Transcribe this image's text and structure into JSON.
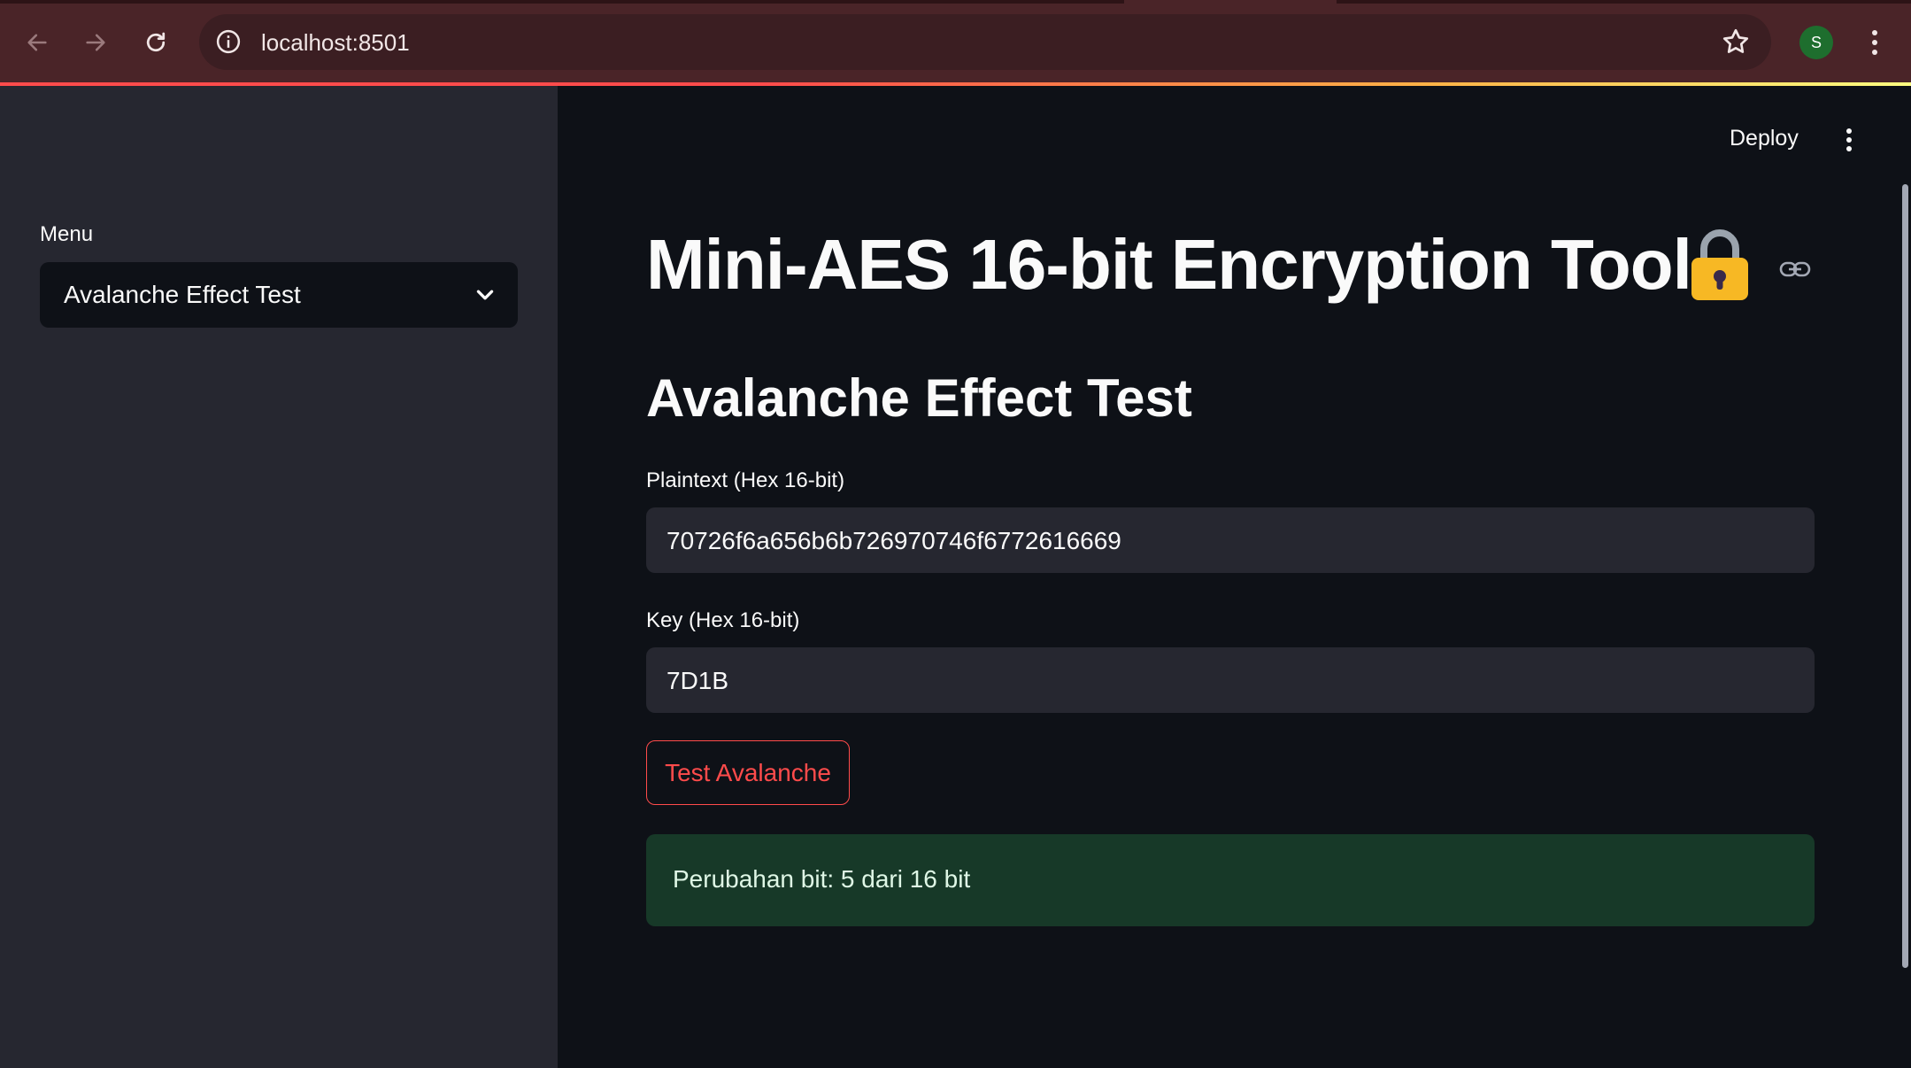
{
  "browser": {
    "url": "localhost:8501",
    "profile_initial": "S",
    "icons": [
      "back-arrow-icon",
      "forward-arrow-icon",
      "reload-icon",
      "info-icon",
      "star-icon",
      "more-vert-icon"
    ]
  },
  "sidebar": {
    "menu_label": "Menu",
    "selected_option": "Avalanche Effect Test"
  },
  "header": {
    "deploy_label": "Deploy"
  },
  "main": {
    "title": "Mini-AES 16-bit Encryption Tool",
    "subtitle": "Avalanche Effect Test",
    "plaintext_label": "Plaintext (Hex 16-bit)",
    "plaintext_value": "70726f6a656b6b726970746f6772616669",
    "key_label": "Key (Hex 16-bit)",
    "key_value": "7D1B",
    "button_label": "Test Avalanche",
    "result_text": "Perubahan bit: 5 dari 16 bit"
  },
  "colors": {
    "chrome": "#4a2428",
    "sidebar": "#262730",
    "main_bg": "#0e1117",
    "accent": "#ff4b4b",
    "success_bg": "#173928"
  }
}
